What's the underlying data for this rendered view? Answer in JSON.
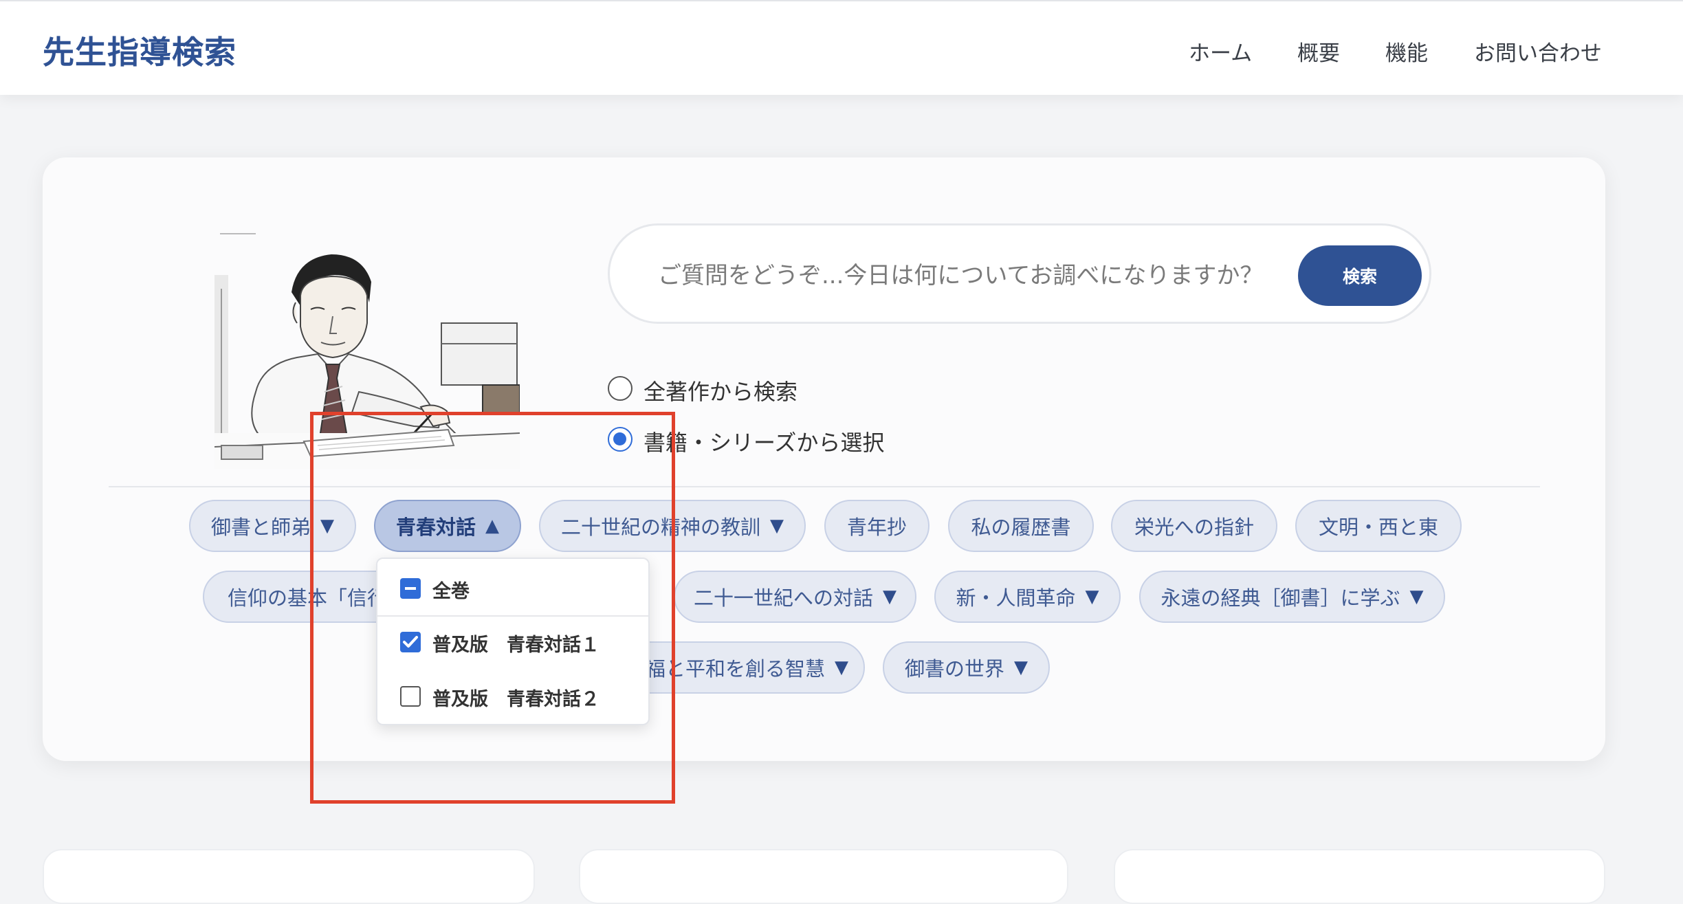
{
  "header": {
    "logo": "先生指導検索",
    "nav": [
      "ホーム",
      "概要",
      "機能",
      "お問い合わせ"
    ]
  },
  "portrait": {
    "icon": "sketch-portrait-man-writing"
  },
  "search": {
    "placeholder": "ご質問をどうぞ...今日は何についてお調べになりますか？",
    "button": "検索"
  },
  "scope": {
    "options": [
      "全著作から検索",
      "書籍・シリーズから選択"
    ],
    "selected": 1
  },
  "books": {
    "row1": [
      "御書と師弟",
      "青春対話",
      "二十世紀の精神の教訓",
      "青年抄",
      "私の履歴書",
      "栄光への指針",
      "文明・西と東"
    ],
    "row2": [
      "信仰の基本「信行学」",
      "二十一世紀への対話",
      "新・人間革命",
      "永遠の経典［御書］に学ぶ"
    ],
    "row3": [
      "幸福と平和を創る智慧",
      "御書の世界"
    ],
    "visible_row2_0": "信仰の基本「信行",
    "visible_row3_0": "福と平和を創る智慧",
    "arrow_down": "▼",
    "arrow_up": "▲",
    "open": "青春対話"
  },
  "dropdown": {
    "items": [
      {
        "label": "全巻",
        "state": "indeterminate"
      },
      {
        "label": "普及版　青春対話１",
        "state": "checked"
      },
      {
        "label": "普及版　青春対話２",
        "state": "unchecked"
      }
    ]
  },
  "colors": {
    "accent": "#2f5294",
    "chip_bg": "#e6eaf3",
    "checkbox": "#2f6cd8",
    "highlight": "#e0412c"
  }
}
